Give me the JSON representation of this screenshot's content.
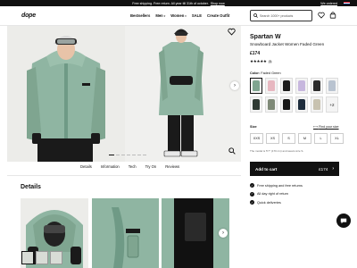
{
  "announcement": {
    "text": "Free shipping. Free return. All year till 31th of october.",
    "link": "Shop now",
    "region": "We ordered",
    "currency": "UK ▾"
  },
  "header": {
    "logo": "dope",
    "nav": [
      "Bestsellers",
      "Men",
      "Women",
      "SALE",
      "Create Outfit"
    ],
    "nav_with_caret": [
      false,
      true,
      true,
      false,
      false
    ],
    "search_placeholder": "Search 1000+ products"
  },
  "gallery": {
    "tabs": [
      "Details",
      "Information",
      "Tech",
      "Try On",
      "Reviews"
    ],
    "dot_count": 7,
    "active_dot": 0
  },
  "details": {
    "heading": "Details",
    "thumb_count": 3
  },
  "product": {
    "title": "Spartan W",
    "subtitle": "Snowboard Jacket Women Faded Green",
    "price": "£174",
    "stars": "★★★★★",
    "review_count": "(5)",
    "color_label": "Color:",
    "color_value": "Faded Green",
    "swatches": [
      {
        "color": "#7fa590",
        "selected": true
      },
      {
        "color": "#e7b7c0"
      },
      {
        "color": "#1b1b1b"
      },
      {
        "color": "#c7b7de"
      },
      {
        "color": "#2b2b2b"
      },
      {
        "color": "#b9c3d0"
      },
      {
        "color": "#2f3a33"
      },
      {
        "color": "#7f8a78"
      },
      {
        "color": "#151515"
      },
      {
        "color": "#1e2d3d"
      },
      {
        "color": "#c8c2b0"
      }
    ],
    "more_swatches": "+2",
    "size_label": "Size",
    "fit_link": "Find your size",
    "sizes": [
      "XXS",
      "XS",
      "S",
      "M",
      "L",
      "XL"
    ],
    "size_note": "The model is 5'7\" (170 cm) and wears size S.",
    "cart_label": "Add to cart",
    "cart_price": "£174",
    "perks": [
      "Free shipping and free returns",
      "All day right of return",
      "Quick deliveries"
    ]
  },
  "colors": {
    "jacket": "#8fb5a2",
    "jacket_dark": "#6f9a86",
    "pants": "#1a1a1a",
    "skin": "#e8c3a8",
    "bg": "#ecece9"
  }
}
